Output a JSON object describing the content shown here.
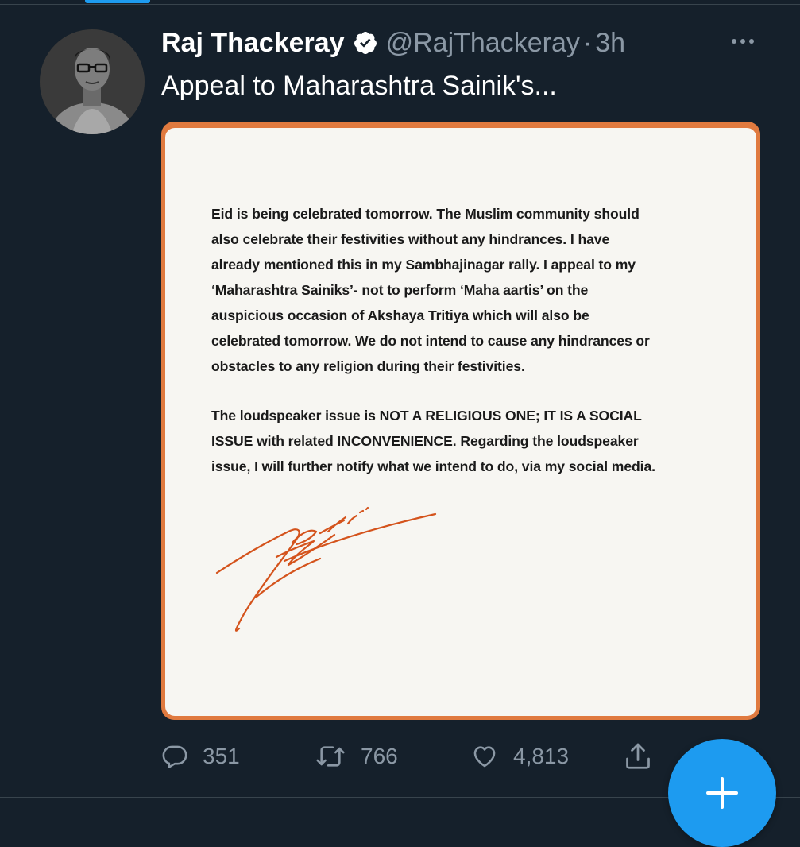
{
  "tweet": {
    "author_name": "Raj Thackeray",
    "author_handle": "@RajThackeray",
    "separator": "·",
    "time": "3h",
    "text": "Appeal to Maharashtra Sainik's..."
  },
  "letter": {
    "paragraph1": [
      "Eid is being celebrated tomorrow.  The Muslim community should",
      "also celebrate their festivities without any hindrances.  I have",
      "already mentioned this in my Sambhajinagar rally.  I appeal to my",
      "‘Maharashtra  Sainiks’- not to perform ‘Maha aartis’ on the",
      "auspicious occasion of Akshaya Tritiya which will also be",
      "celebrated tomorrow.  We do not intend to cause any hindrances or",
      "obstacles to any religion during their festivities."
    ],
    "paragraph2": [
      "The loudspeaker issue is NOT A RELIGIOUS ONE; IT IS A SOCIAL",
      "ISSUE with related INCONVENIENCE.  Regarding the loudspeaker",
      "issue, I will further notify what we intend to do, via my social media."
    ],
    "border_color": "#e07a3f",
    "signature_color": "#d4531c"
  },
  "actions": {
    "reply_count": "351",
    "retweet_count": "766",
    "like_count": "4,813"
  },
  "icons": {
    "verified": "verified-badge-icon",
    "more": "more-icon",
    "reply": "reply-icon",
    "retweet": "retweet-icon",
    "like": "heart-icon",
    "share": "share-icon",
    "compose": "plus-icon"
  },
  "colors": {
    "background": "#15202b",
    "accent": "#1d9bf0",
    "secondary_text": "#8b98a5"
  }
}
